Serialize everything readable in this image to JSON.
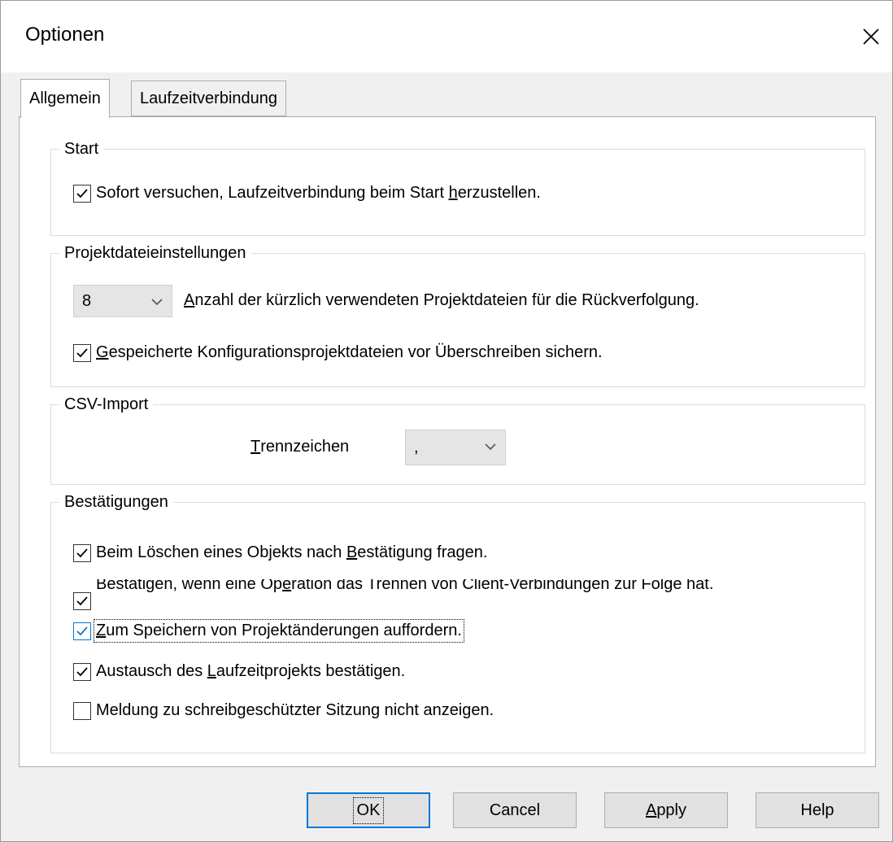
{
  "window": {
    "title": "Optionen"
  },
  "tabs": [
    {
      "label": "Allgemein",
      "active": true
    },
    {
      "label": "Laufzeitverbindung",
      "active": false
    }
  ],
  "start": {
    "legend": "Start",
    "auto_connect": {
      "label_pre": "Sofort versuchen, Laufzeitverbindung beim Start ",
      "label_accel": "h",
      "label_post": "erzustellen.",
      "checked": true
    }
  },
  "project": {
    "legend": "Projektdateieinstellungen",
    "recent_count": {
      "value": "8",
      "label_accel": "A",
      "label_post": "nzahl der kürzlich verwendeten Projektdateien für die Rückverfolgung."
    },
    "backup": {
      "label_accel": "G",
      "label_post": "espeicherte Konfigurationsprojektdateien vor Überschreiben sichern.",
      "checked": true
    }
  },
  "csv": {
    "legend": "CSV-Import",
    "delimiter_label_accel": "T",
    "delimiter_label_post": "rennzeichen",
    "delimiter_value": ","
  },
  "confirmations": {
    "legend": "Bestätigungen",
    "items": [
      {
        "pre": "Beim Löschen eines Objekts nach ",
        "accel": "B",
        "post": "estätigung fragen.",
        "checked": true
      },
      {
        "pre": "Bestätigen, wenn eine Op",
        "accel": "e",
        "post": "ration das Trennen von Client-Verbindungen zur Folge hat.",
        "checked": true
      },
      {
        "pre": "",
        "accel": "Z",
        "post": "um Speichern von Projektänderungen auffordern.",
        "checked": true
      },
      {
        "pre": "Austausch des ",
        "accel": "L",
        "post": "aufzeitprojekts bestätigen.",
        "checked": true
      },
      {
        "pre": "Meldung zu schreibgeschützter Sitzung nicht anzeigen.",
        "accel": "",
        "post": "",
        "checked": false
      }
    ]
  },
  "buttons": {
    "ok": "OK",
    "cancel": "Cancel",
    "apply_accel": "A",
    "apply_post": "pply",
    "help": "Help"
  },
  "colors": {
    "accent": "#0078d7",
    "dialog_bg": "#f0f0f0",
    "panel_bg": "#ffffff"
  },
  "icons": {
    "close": "close-icon",
    "check": "check-icon",
    "dropdown": "chevron-down-icon"
  }
}
